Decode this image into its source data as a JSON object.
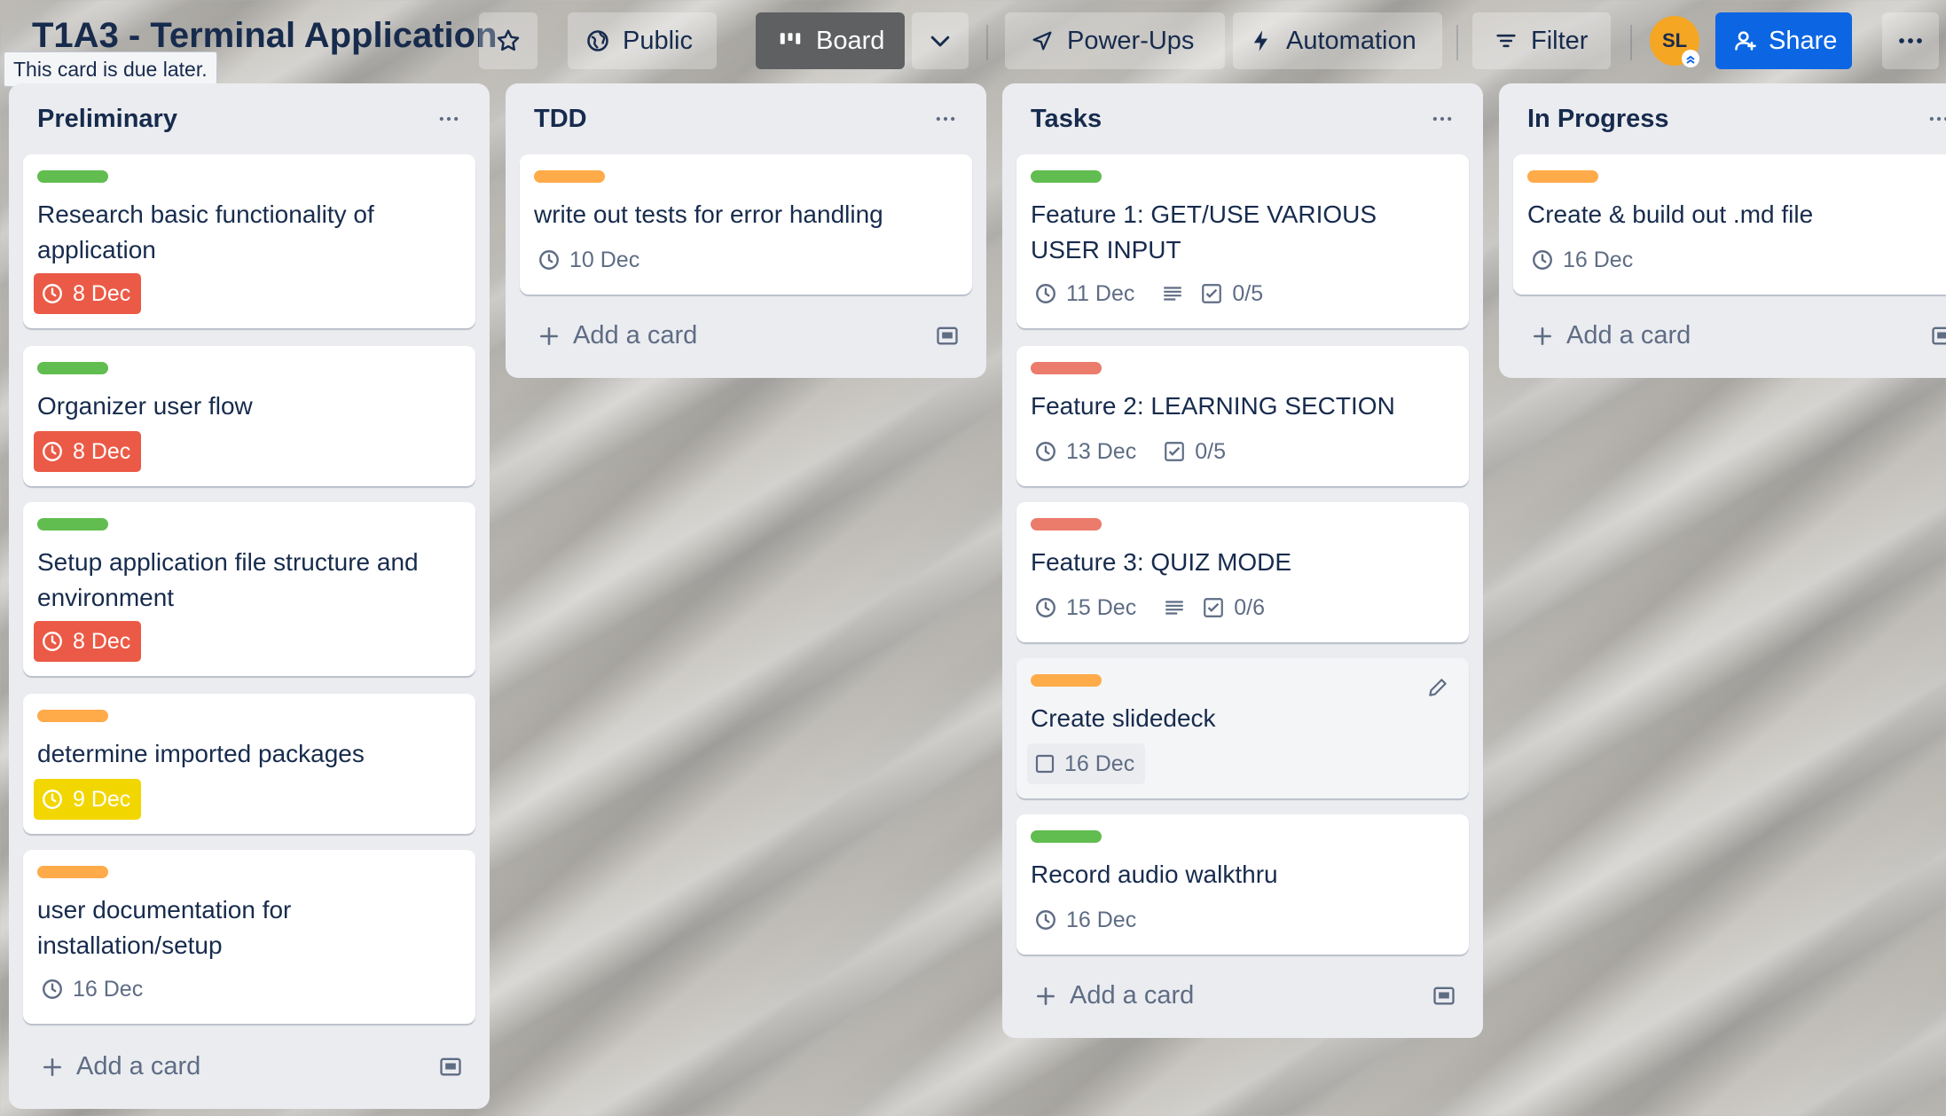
{
  "header": {
    "board_title": "T1A3 - Terminal Application",
    "tooltip": "This card is due later.",
    "visibility_label": "Public",
    "view_label": "Board",
    "powerups_label": "Power-Ups",
    "automation_label": "Automation",
    "filter_label": "Filter",
    "avatar_initials": "SL",
    "share_label": "Share"
  },
  "colors": {
    "green": "#61bd4f",
    "orange": "#ffab4a",
    "red": "#eb5a46",
    "yellow": "#f2d600",
    "share_blue": "#0c66e4"
  },
  "lists": [
    {
      "title": "Preliminary",
      "add_label": "Add a card",
      "cards": [
        {
          "label": "green",
          "title": "Research basic functionality of application",
          "due": "8 Dec",
          "due_style": "red"
        },
        {
          "label": "green",
          "title": "Organizer user flow",
          "due": "8 Dec",
          "due_style": "red"
        },
        {
          "label": "green",
          "title": "Setup application file structure and environment",
          "due": "8 Dec",
          "due_style": "red"
        },
        {
          "label": "orange",
          "title": "determine imported packages",
          "due": "9 Dec",
          "due_style": "yellow"
        },
        {
          "label": "orange",
          "title": "user documentation for installation/setup",
          "due": "16 Dec",
          "due_style": "plain"
        }
      ]
    },
    {
      "title": "TDD",
      "add_label": "Add a card",
      "cards": [
        {
          "label": "orange",
          "title": "write out tests for error handling",
          "due": "10 Dec",
          "due_style": "plain"
        }
      ]
    },
    {
      "title": "Tasks",
      "add_label": "Add a card",
      "cards": [
        {
          "label": "green",
          "title": "Feature 1: GET/USE VARIOUS USER INPUT",
          "due": "11 Dec",
          "due_style": "plain",
          "has_description": true,
          "checklist": "0/5"
        },
        {
          "label": "red",
          "title": "Feature 2: LEARNING SECTION",
          "due": "13 Dec",
          "due_style": "plain",
          "checklist": "0/5"
        },
        {
          "label": "red",
          "title": "Feature 3: QUIZ MODE",
          "due": "15 Dec",
          "due_style": "plain",
          "has_description": true,
          "checklist": "0/6"
        },
        {
          "label": "orange",
          "title": "Create slidedeck",
          "due": "16 Dec",
          "due_style": "checkbox"
        },
        {
          "label": "green",
          "title": "Record audio walkthru",
          "due": "16 Dec",
          "due_style": "plain"
        }
      ]
    },
    {
      "title": "In Progress",
      "add_label": "Add a card",
      "cards": [
        {
          "label": "orange",
          "title": "Create & build out .md file",
          "due": "16 Dec",
          "due_style": "plain"
        }
      ]
    }
  ]
}
